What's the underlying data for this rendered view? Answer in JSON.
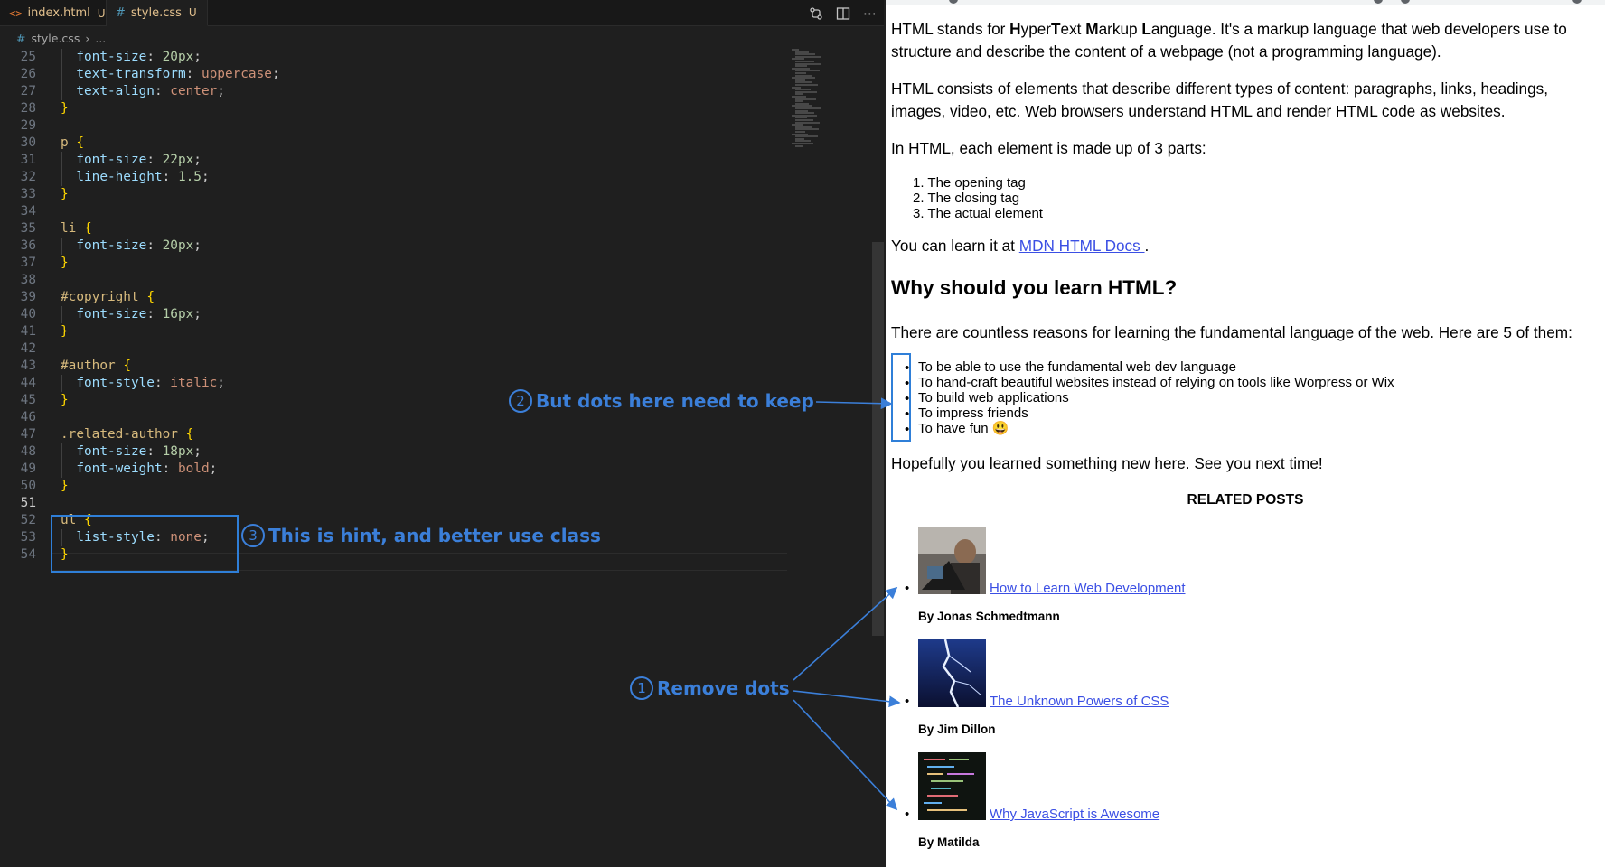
{
  "editor": {
    "tabs": [
      {
        "label": "index.html",
        "status": "U",
        "icon": "html-file-icon"
      },
      {
        "label": "style.css",
        "status": "U",
        "icon": "css-file-icon"
      }
    ],
    "breadcrumb": {
      "file": "style.css",
      "rest": "..."
    },
    "lines": [
      {
        "n": "25",
        "tokens": [
          [
            "prop",
            "  font-size"
          ],
          [
            "punct",
            ": "
          ],
          [
            "num",
            "20px"
          ],
          [
            "punct",
            ";"
          ]
        ]
      },
      {
        "n": "26",
        "tokens": [
          [
            "prop",
            "  text-transform"
          ],
          [
            "punct",
            ": "
          ],
          [
            "val",
            "uppercase"
          ],
          [
            "punct",
            ";"
          ]
        ]
      },
      {
        "n": "27",
        "tokens": [
          [
            "prop",
            "  text-align"
          ],
          [
            "punct",
            ": "
          ],
          [
            "val",
            "center"
          ],
          [
            "punct",
            ";"
          ]
        ]
      },
      {
        "n": "28",
        "tokens": [
          [
            "brace",
            "}"
          ]
        ]
      },
      {
        "n": "29",
        "tokens": []
      },
      {
        "n": "30",
        "tokens": [
          [
            "sel",
            "p "
          ],
          [
            "brace",
            "{"
          ]
        ]
      },
      {
        "n": "31",
        "tokens": [
          [
            "prop",
            "  font-size"
          ],
          [
            "punct",
            ": "
          ],
          [
            "num",
            "22px"
          ],
          [
            "punct",
            ";"
          ]
        ]
      },
      {
        "n": "32",
        "tokens": [
          [
            "prop",
            "  line-height"
          ],
          [
            "punct",
            ": "
          ],
          [
            "num",
            "1.5"
          ],
          [
            "punct",
            ";"
          ]
        ]
      },
      {
        "n": "33",
        "tokens": [
          [
            "brace",
            "}"
          ]
        ]
      },
      {
        "n": "34",
        "tokens": []
      },
      {
        "n": "35",
        "tokens": [
          [
            "sel",
            "li "
          ],
          [
            "brace",
            "{"
          ]
        ]
      },
      {
        "n": "36",
        "tokens": [
          [
            "prop",
            "  font-size"
          ],
          [
            "punct",
            ": "
          ],
          [
            "num",
            "20px"
          ],
          [
            "punct",
            ";"
          ]
        ]
      },
      {
        "n": "37",
        "tokens": [
          [
            "brace",
            "}"
          ]
        ]
      },
      {
        "n": "38",
        "tokens": []
      },
      {
        "n": "39",
        "tokens": [
          [
            "sel",
            "#copyright "
          ],
          [
            "brace",
            "{"
          ]
        ]
      },
      {
        "n": "40",
        "tokens": [
          [
            "prop",
            "  font-size"
          ],
          [
            "punct",
            ": "
          ],
          [
            "num",
            "16px"
          ],
          [
            "punct",
            ";"
          ]
        ]
      },
      {
        "n": "41",
        "tokens": [
          [
            "brace",
            "}"
          ]
        ]
      },
      {
        "n": "42",
        "tokens": []
      },
      {
        "n": "43",
        "tokens": [
          [
            "sel",
            "#author "
          ],
          [
            "brace",
            "{"
          ]
        ]
      },
      {
        "n": "44",
        "tokens": [
          [
            "prop",
            "  font-style"
          ],
          [
            "punct",
            ": "
          ],
          [
            "val",
            "italic"
          ],
          [
            "punct",
            ";"
          ]
        ]
      },
      {
        "n": "45",
        "tokens": [
          [
            "brace",
            "}"
          ]
        ]
      },
      {
        "n": "46",
        "tokens": []
      },
      {
        "n": "47",
        "tokens": [
          [
            "sel",
            ".related-author "
          ],
          [
            "brace",
            "{"
          ]
        ]
      },
      {
        "n": "48",
        "tokens": [
          [
            "prop",
            "  font-size"
          ],
          [
            "punct",
            ": "
          ],
          [
            "num",
            "18px"
          ],
          [
            "punct",
            ";"
          ]
        ]
      },
      {
        "n": "49",
        "tokens": [
          [
            "prop",
            "  font-weight"
          ],
          [
            "punct",
            ": "
          ],
          [
            "val",
            "bold"
          ],
          [
            "punct",
            ";"
          ]
        ]
      },
      {
        "n": "50",
        "tokens": [
          [
            "brace",
            "}"
          ]
        ]
      },
      {
        "n": "51",
        "tokens": []
      },
      {
        "n": "52",
        "tokens": [
          [
            "sel",
            "ul "
          ],
          [
            "brace",
            "{"
          ]
        ]
      },
      {
        "n": "53",
        "tokens": [
          [
            "prop",
            "  list-style"
          ],
          [
            "punct",
            ": "
          ],
          [
            "val",
            "none"
          ],
          [
            "punct",
            ";"
          ]
        ]
      },
      {
        "n": "54",
        "tokens": [
          [
            "brace",
            "}"
          ]
        ]
      }
    ],
    "current_line": "51"
  },
  "browser": {
    "intro_p1_parts": [
      "HTML stands for ",
      "H",
      "yper",
      "T",
      "ext ",
      "M",
      "arkup ",
      "L",
      "anguage. It's a markup language that web developers use to structure and describe the content of a webpage (not a programming language)."
    ],
    "intro_p2": "HTML consists of elements that describe different types of content: paragraphs, links, headings, images, video, etc. Web browsers understand HTML and render HTML code as websites.",
    "intro_p3": "In HTML, each element is made up of 3 parts:",
    "parts_list": [
      "The opening tag",
      "The closing tag",
      "The actual element"
    ],
    "learn_text": "You can learn it at ",
    "learn_link": "MDN HTML Docs ",
    "learn_end": ".",
    "why_heading": "Why should you learn HTML?",
    "reasons_intro": "There are countless reasons for learning the fundamental language of the web. Here are 5 of them:",
    "reasons": [
      "To be able to use the fundamental web dev language",
      "To hand-craft beautiful websites instead of relying on tools like Worpress or Wix",
      "To build web applications",
      "To impress friends",
      "To have fun 😃"
    ],
    "closing": "Hopefully you learned something new here. See you next time!",
    "related_title": "RELATED POSTS",
    "posts": [
      {
        "title": "How to Learn Web Development",
        "author": "By Jonas Schmedtmann"
      },
      {
        "title": "The Unknown Powers of CSS",
        "author": "By Jim Dillon"
      },
      {
        "title": "Why JavaScript is Awesome",
        "author": "By Matilda"
      }
    ]
  },
  "annotations": {
    "a1": {
      "num": "1",
      "text": "Remove dots"
    },
    "a2": {
      "num": "2",
      "text": "But dots here need to keep"
    },
    "a3": {
      "num": "3",
      "text": "This is hint, and better use class"
    },
    "color": "#3b7fd9"
  }
}
